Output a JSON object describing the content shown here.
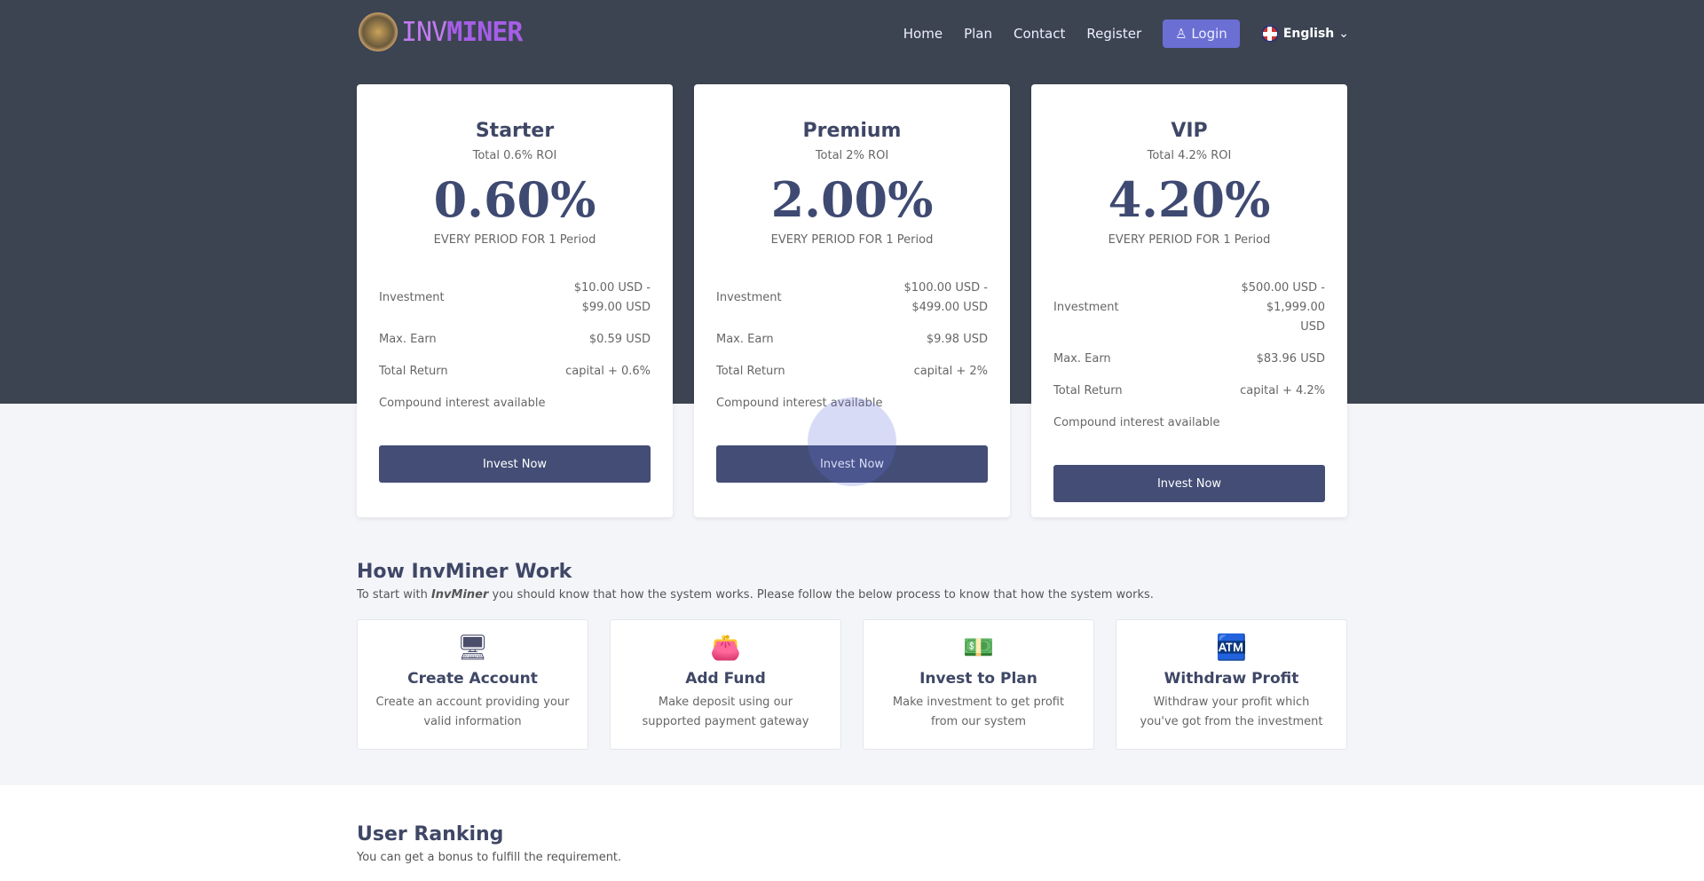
{
  "header": {
    "logo_text_a": "INV",
    "logo_text_b": "MINER",
    "nav": [
      "Home",
      "Plan",
      "Contact",
      "Register"
    ],
    "login": "Login",
    "language": "English"
  },
  "plans": [
    {
      "name": "Starter",
      "roi": "Total 0.6% ROI",
      "rate": "0.60%",
      "period": "EVERY PERIOD FOR 1 Period",
      "investment_label": "Investment",
      "investment": "$10.00 USD - $99.00 USD",
      "max_label": "Max. Earn",
      "max": "$0.59 USD",
      "return_label": "Total Return",
      "return": "capital + 0.6%",
      "compound": "Compound interest available",
      "button": "Invest Now"
    },
    {
      "name": "Premium",
      "roi": "Total 2% ROI",
      "rate": "2.00%",
      "period": "EVERY PERIOD FOR 1 Period",
      "investment_label": "Investment",
      "investment": "$100.00 USD - $499.00 USD",
      "max_label": "Max. Earn",
      "max": "$9.98 USD",
      "return_label": "Total Return",
      "return": "capital + 2%",
      "compound": "Compound interest available",
      "button": "Invest Now"
    },
    {
      "name": "VIP",
      "roi": "Total 4.2% ROI",
      "rate": "4.20%",
      "period": "EVERY PERIOD FOR 1 Period",
      "investment_label": "Investment",
      "investment": "$500.00 USD - $1,999.00 USD",
      "max_label": "Max. Earn",
      "max": "$83.96 USD",
      "return_label": "Total Return",
      "return": "capital + 4.2%",
      "compound": "Compound interest available",
      "button": "Invest Now"
    }
  ],
  "how": {
    "title": "How InvMiner Work",
    "sub_a": "To start with ",
    "sub_brand": "InvMiner",
    "sub_b": " you should know that how the system works. Please follow the below process to know that how the system works.",
    "steps": [
      {
        "icon": "computer-user-icon",
        "glyph": "🖥",
        "title": "Create Account",
        "text": "Create an account providing your valid information"
      },
      {
        "icon": "wallet-icon",
        "glyph": "👛",
        "title": "Add Fund",
        "text": "Make deposit using our supported payment gateway"
      },
      {
        "icon": "money-chart-icon",
        "glyph": "💵",
        "title": "Invest to Plan",
        "text": "Make investment to get profit from our system"
      },
      {
        "icon": "withdraw-icon",
        "glyph": "🏧",
        "title": "Withdraw Profit",
        "text": "Withdraw your profit which you've got from the investment"
      }
    ]
  },
  "ranking": {
    "title": "User Ranking",
    "sub": "You can get a bonus to fulfill the requirement."
  }
}
